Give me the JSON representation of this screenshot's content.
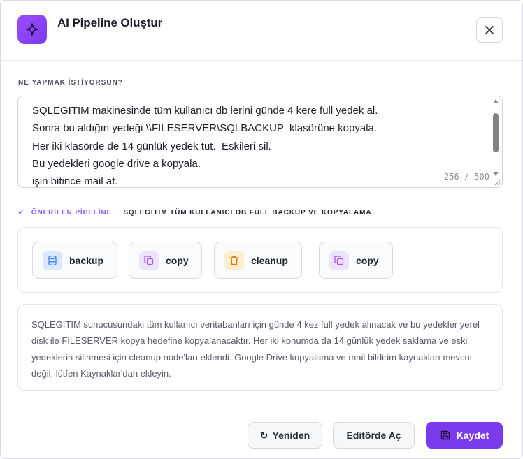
{
  "dialog": {
    "title": "AI Pipeline Oluştur",
    "accent_color": "#7c3aed",
    "header_icon": "sparkle-icon",
    "close_icon": "close-icon"
  },
  "prompt": {
    "label": "NE YAPMAK İSTİYORSUN?",
    "value": "SQLEGITIM makinesinde tüm kullanıcı db lerini günde 4 kere full yedek al.\nSonra bu aldığın yedeği \\\\FILESERVER\\SQLBACKUP  klasörüne kopyala.\nHer iki klasörde de 14 günlük yedek tut.  Eskileri sil.\nBu yedekleri google drive a kopyala.\nişin bitince mail at.",
    "counter": "256 / 500"
  },
  "suggestion": {
    "check_icon": "check-icon",
    "label": "ÖNERİLEN PİPELİNE",
    "separator": "·",
    "name": "SQLEGITIM TÜM KULLANICI DB FULL BACKUP VE KOPYALAMA"
  },
  "nodes": [
    {
      "label": "backup",
      "icon": "database-icon",
      "color": "#3b82f6"
    },
    {
      "label": "copy",
      "icon": "copy-icon",
      "color": "#a855f7"
    },
    {
      "label": "cleanup",
      "icon": "trash-icon",
      "color": "#d97706"
    },
    {
      "label": "copy",
      "icon": "copy-icon",
      "color": "#a855f7"
    }
  ],
  "description": "SQLEGITIM sunucusundaki tüm kullanıcı veritabanları için günde 4 kez full yedek alınacak ve bu yedekler yerel disk ile FILESERVER kopya hedefine kopyalanacaktır. Her iki konumda da 14 günlük yedek saklama ve eski yedeklerin silinmesi için cleanup node'ları eklendi. Google Drive kopyalama ve mail bildirim kaynakları mevcut değil, lütfen Kaynaklar'dan ekleyin.",
  "footer": {
    "retry_icon": "↻",
    "retry_label": "Yeniden",
    "editor_label": "Editörde Aç",
    "save_icon": "save-icon",
    "save_label": "Kaydet"
  }
}
